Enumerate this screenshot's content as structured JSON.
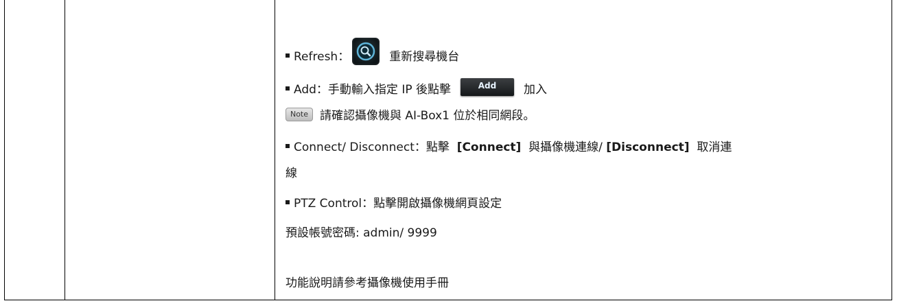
{
  "refresh": {
    "label": "Refresh：",
    "icon": "search-magnifier-icon",
    "desc": "重新搜尋機台"
  },
  "add": {
    "label": "Add：手動輸入指定 IP 後點擊",
    "button_label": "Add",
    "desc": "加入"
  },
  "note": {
    "badge": "Note",
    "text": "請確認攝像機與 AI-Box1 位於相同網段。"
  },
  "connect": {
    "prefix": "Connect/ Disconnect：點擊",
    "connect_label": "[Connect]",
    "middle": "與攝像機連線/",
    "disconnect_label": "[Disconnect]",
    "suffix": "取消連",
    "wrap": "線"
  },
  "ptz": {
    "label": "PTZ Control：點擊開啟攝像機網頁設定"
  },
  "default_account": "預設帳號密碼: admin/ 9999",
  "manual_ref": "功能說明請參考攝像機使用手冊",
  "colors": {
    "border": "#000000",
    "text": "#1a1a1a",
    "icon_ring": "#5fb4d8",
    "button_bg": "#222629"
  }
}
